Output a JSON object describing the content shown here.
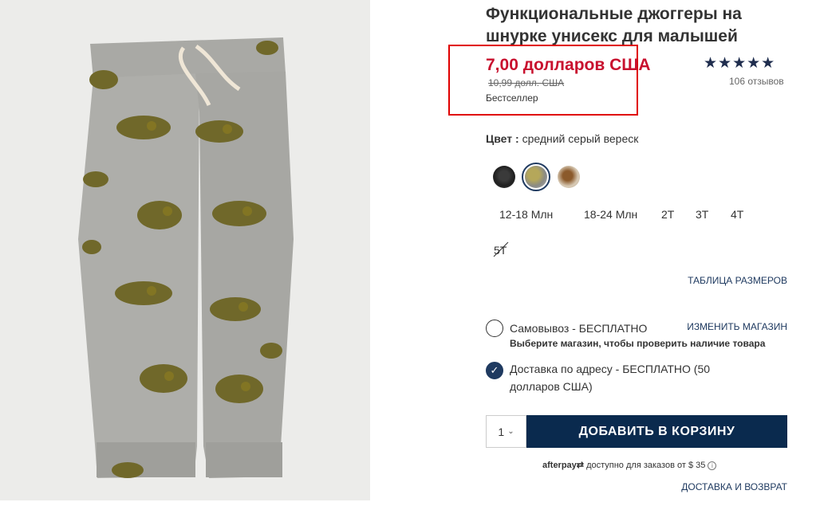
{
  "product": {
    "title": "Функциональные джоггеры на шнурке унисекс для малышей",
    "price": "7,00 долларов США",
    "old_price": "10,99 долл. США",
    "badge": "Бестселлер",
    "rating_stars": "★★★★★",
    "rating_value": 4.5,
    "reviews": "106 отзывов",
    "image_icon": "dino-print-jogger-pants"
  },
  "color": {
    "label": "Цвет :",
    "value": "средний серый вереск",
    "swatches": [
      "black-dino",
      "medium-gray-heather",
      "tan-dino"
    ]
  },
  "sizes": {
    "options": [
      "12-18 Млн",
      "18-24 Млн",
      "2T",
      "3T",
      "4T",
      "5T"
    ],
    "unavailable": "5T",
    "chart_link": "ТАБЛИЦА РАЗМЕРОВ"
  },
  "fulfillment": {
    "pickup_label": "Самовывоз - БЕСПЛАТНО",
    "change_store": "ИЗМЕНИТЬ МАГАЗИН",
    "pickup_hint": "Выберите магазин, чтобы проверить наличие товара",
    "shipping_label": "Доставка по адресу - БЕСПЛАТНО (50 долларов США)"
  },
  "cart": {
    "qty": "1",
    "add_label": "ДОБАВИТЬ В КОРЗИНУ"
  },
  "afterpay": {
    "brand": "afterpay",
    "text": "доступно для заказов от $ 35"
  },
  "footer": {
    "delivery_link": "ДОСТАВКА И ВОЗВРАТ"
  },
  "colors": {
    "accent_navy": "#0a2a4e",
    "price_red": "#c8102e",
    "highlight_box": "#e00000"
  }
}
